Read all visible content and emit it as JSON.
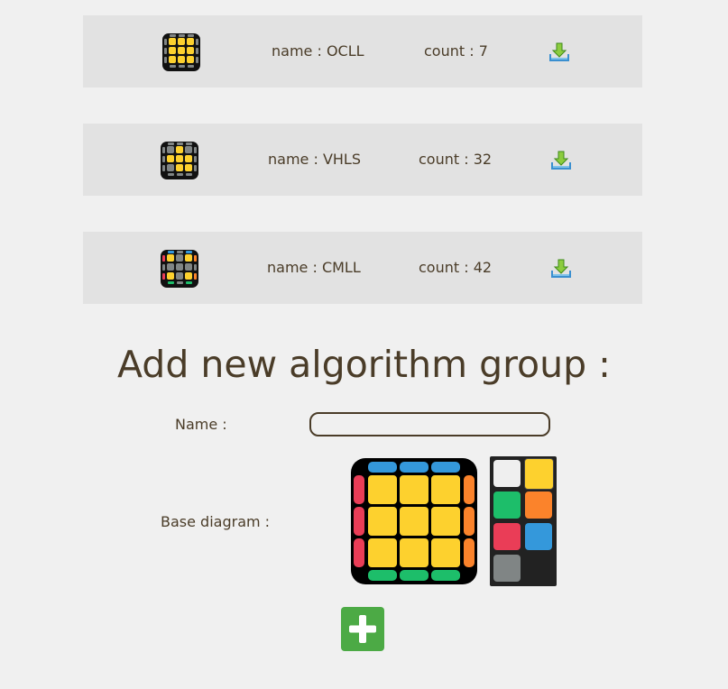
{
  "groups": [
    {
      "name_text": "name : OCLL",
      "count_text": "count : 7",
      "thumb_icon": "ocll-cube-icon"
    },
    {
      "name_text": "name : VHLS",
      "count_text": "count : 32",
      "thumb_icon": "vhls-cube-icon"
    },
    {
      "name_text": "name : CMLL",
      "count_text": "count : 42",
      "thumb_icon": "cmll-cube-icon"
    }
  ],
  "form": {
    "heading": "Add new algorithm group :",
    "name_label": "Name :",
    "name_value": "",
    "base_diagram_label": "Base diagram :"
  },
  "colors": {
    "yellow": "#fdd12e",
    "blue": "#3498db",
    "green": "#1dbe6a",
    "red": "#ea3d57",
    "orange": "#fb832b",
    "white": "#efefef",
    "gray": "#808585",
    "accent_green": "#4caa45"
  },
  "palette": [
    "white",
    "yellow",
    "green",
    "orange",
    "red",
    "blue",
    "gray"
  ],
  "icons": {
    "download": "download-icon",
    "add": "plus-icon"
  }
}
